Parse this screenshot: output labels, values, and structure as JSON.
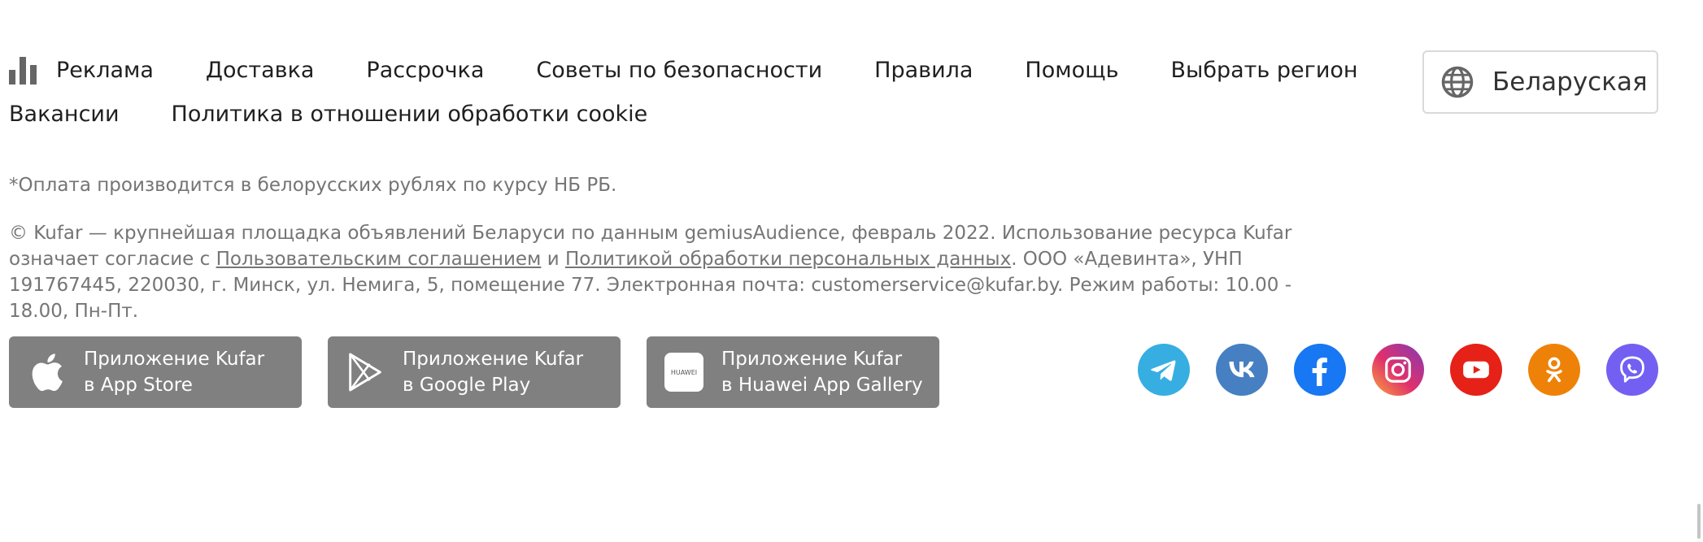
{
  "nav": {
    "row1": [
      "Реклама",
      "Доставка",
      "Рассрочка",
      "Советы по безопасности",
      "Правила",
      "Помощь",
      "Выбрать регион"
    ],
    "row2": [
      "Вакансии",
      "Политика в отношении обработки cookie"
    ]
  },
  "language": {
    "label": "Беларуская",
    "icon": "globe-icon"
  },
  "payment_note": "*Оплата производится в белорусских рублях по курсу НБ РБ.",
  "legal": {
    "part1": "© Kufar — крупнейшая площадка объявлений Беларуси по данным gemiusAudience, февраль 2022. Использование ресурса Kufar означает согласие с ",
    "link1": "Пользовательским соглашением",
    "and": " и ",
    "link2": "Политикой обработки персональных данных",
    "part2": ". ООО «Адевинта», УНП 191767445, 220030, г. Минск, ул. Немига, 5, помещение 77. Электронная почта: customerservice@kufar.by. Режим работы: 10.00 - 18.00, Пн-Пт."
  },
  "apps": [
    {
      "line1": "Приложение Kufar",
      "line2": "в App Store",
      "icon": "apple-icon"
    },
    {
      "line1": "Приложение Kufar",
      "line2": "в Google Play",
      "icon": "google-play-icon"
    },
    {
      "line1": "Приложение Kufar",
      "line2": "в Huawei App Gallery",
      "icon": "huawei-icon",
      "logo_text": "HUAWEI"
    }
  ],
  "social": [
    {
      "name": "telegram",
      "color": "#37aee2"
    },
    {
      "name": "vk",
      "color": "#4680c2"
    },
    {
      "name": "facebook",
      "color": "#1877f2"
    },
    {
      "name": "instagram",
      "color": "#c13584"
    },
    {
      "name": "youtube",
      "color": "#e62117"
    },
    {
      "name": "odnoklassniki",
      "color": "#ee8208"
    },
    {
      "name": "viber",
      "color": "#7360f2"
    }
  ]
}
